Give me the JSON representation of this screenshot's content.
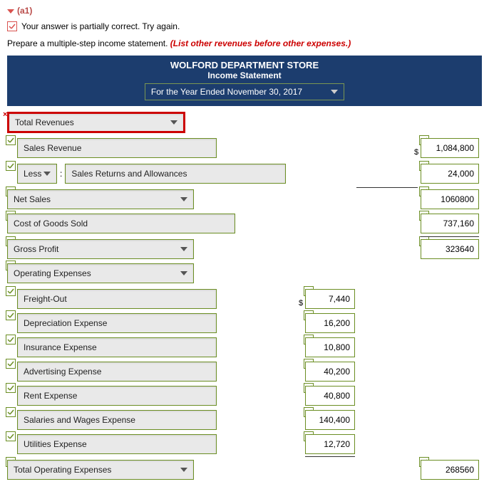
{
  "section_label": "(a1)",
  "feedback_text": "Your answer is partially correct.  Try again.",
  "instruction": "Prepare a multiple-step income statement.",
  "instruction_note": "(List other revenues before other expenses.)",
  "header": {
    "company": "WOLFORD DEPARTMENT STORE",
    "title": "Income Statement",
    "period": "For the Year Ended November 30, 2017"
  },
  "rows": {
    "total_revenues": "Total Revenues",
    "sales_revenue": {
      "label": "Sales Revenue",
      "value": "1,084,800"
    },
    "less": "Less",
    "sales_returns": {
      "label": "Sales Returns and Allowances",
      "value": "24,000"
    },
    "net_sales": {
      "label": "Net Sales",
      "value": "1060800"
    },
    "cogs": {
      "label": "Cost of Goods Sold",
      "value": "737,160"
    },
    "gross_profit": {
      "label": "Gross Profit",
      "value": "323640"
    },
    "operating_expenses": "Operating Expenses",
    "freight_out": {
      "label": "Freight-Out",
      "value": "7,440"
    },
    "depreciation": {
      "label": "Depreciation Expense",
      "value": "16,200"
    },
    "insurance": {
      "label": "Insurance Expense",
      "value": "10,800"
    },
    "advertising": {
      "label": "Advertising Expense",
      "value": "40,200"
    },
    "rent": {
      "label": "Rent Expense",
      "value": "40,800"
    },
    "salaries": {
      "label": "Salaries and Wages Expense",
      "value": "140,400"
    },
    "utilities": {
      "label": "Utilities Expense",
      "value": "12,720"
    },
    "total_operating": {
      "label": "Total Operating Expenses",
      "value": "268560"
    }
  }
}
